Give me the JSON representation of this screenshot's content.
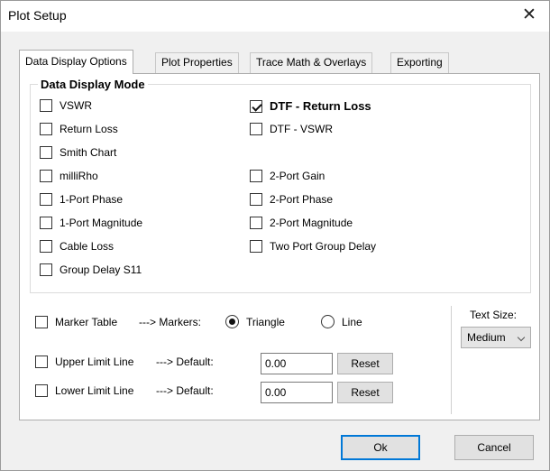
{
  "window": {
    "title": "Plot Setup",
    "close_glyph": "✕"
  },
  "tabs": [
    {
      "label": "Data Display Options",
      "active": true
    },
    {
      "label": "Plot Properties",
      "active": false
    },
    {
      "label": "Trace Math & Overlays",
      "active": false
    },
    {
      "label": "Exporting",
      "active": false
    }
  ],
  "display_mode": {
    "title": "Data Display Mode",
    "options": {
      "vswr": {
        "label": "VSWR",
        "checked": false
      },
      "return_loss": {
        "label": "Return Loss",
        "checked": false
      },
      "smith_chart": {
        "label": "Smith Chart",
        "checked": false
      },
      "millirho": {
        "label": "milliRho",
        "checked": false
      },
      "one_port_phase": {
        "label": "1-Port Phase",
        "checked": false
      },
      "one_port_magnitude": {
        "label": "1-Port Magnitude",
        "checked": false
      },
      "cable_loss": {
        "label": "Cable Loss",
        "checked": false
      },
      "group_delay_s11": {
        "label": "Group Delay S11",
        "checked": false
      },
      "dtf_return_loss": {
        "label": "DTF - Return Loss",
        "checked": true
      },
      "dtf_vswr": {
        "label": "DTF - VSWR",
        "checked": false
      },
      "two_port_gain": {
        "label": "2-Port Gain",
        "checked": false
      },
      "two_port_phase": {
        "label": "2-Port Phase",
        "checked": false
      },
      "two_port_magnitude": {
        "label": "2-Port Magnitude",
        "checked": false
      },
      "two_port_group_delay": {
        "label": "Two Port Group Delay",
        "checked": false
      }
    }
  },
  "markers": {
    "marker_table_label": "Marker Table",
    "arrow_label": "---> Markers:",
    "triangle_label": "Triangle",
    "line_label": "Line",
    "selected": "Triangle"
  },
  "limits": {
    "upper": {
      "label": "Upper Limit Line",
      "arrow": "---> Default:",
      "value": "0.00",
      "reset": "Reset"
    },
    "lower": {
      "label": "Lower Limit Line",
      "arrow": "---> Default:",
      "value": "0.00",
      "reset": "Reset"
    }
  },
  "text_size": {
    "label": "Text Size:",
    "value": "Medium"
  },
  "footer": {
    "ok": "Ok",
    "cancel": "Cancel"
  }
}
